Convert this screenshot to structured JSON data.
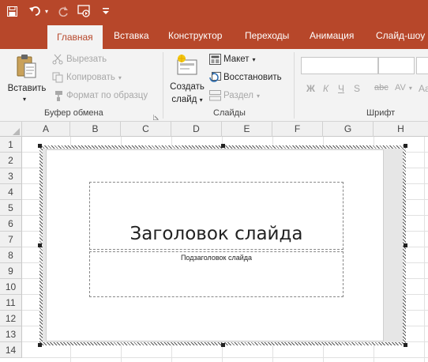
{
  "quick_access": {
    "save_icon": "save-icon",
    "undo_icon": "undo-icon",
    "redo_icon": "redo-icon",
    "start_show_icon": "slideshow-from-start-icon",
    "customize_icon": "customize-qat-icon"
  },
  "tabs": [
    {
      "label": "Главная",
      "active": true
    },
    {
      "label": "Вставка",
      "active": false
    },
    {
      "label": "Конструктор",
      "active": false
    },
    {
      "label": "Переходы",
      "active": false
    },
    {
      "label": "Анимация",
      "active": false
    },
    {
      "label": "Слайд-шоу",
      "active": false
    }
  ],
  "ribbon": {
    "clipboard": {
      "paste_label": "Вставить",
      "cut_label": "Вырезать",
      "copy_label": "Копировать",
      "format_painter_label": "Формат по образцу",
      "group_label": "Буфер обмена"
    },
    "slides": {
      "new_slide_line1": "Создать",
      "new_slide_line2": "слайд",
      "layout_label": "Макет",
      "reset_label": "Восстановить",
      "section_label": "Раздел",
      "group_label": "Слайды"
    },
    "font": {
      "bold": "Ж",
      "italic": "К",
      "underline": "Ч",
      "strike": "S",
      "spacing": "AV",
      "case": "Aa",
      "group_label": "Шрифт"
    }
  },
  "sheet": {
    "columns": [
      "A",
      "B",
      "C",
      "D",
      "E",
      "F",
      "G",
      "H"
    ],
    "rows": [
      "1",
      "2",
      "3",
      "4",
      "5",
      "6",
      "7",
      "8",
      "9",
      "10",
      "11",
      "12",
      "13",
      "14"
    ]
  },
  "slide": {
    "title": "Заголовок слайда",
    "subtitle": "Подзаголовок слайда"
  },
  "colors": {
    "accent": "#b7472a",
    "ribbon_bg": "#f3f3f3"
  }
}
